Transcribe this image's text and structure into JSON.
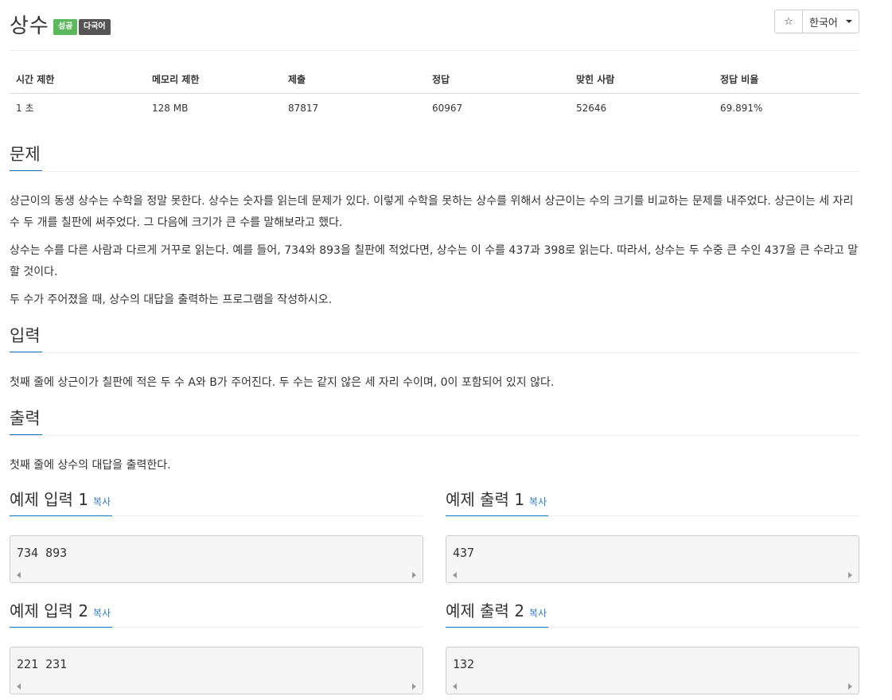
{
  "title": "상수",
  "badges": {
    "success": "성공",
    "multilang": "다국어"
  },
  "toolbar": {
    "star_icon": "☆",
    "language": "한국어"
  },
  "info": {
    "headers": [
      "시간 제한",
      "메모리 제한",
      "제출",
      "정답",
      "맞힌 사람",
      "정답 비율"
    ],
    "values": [
      "1 초",
      "128 MB",
      "87817",
      "60967",
      "52646",
      "69.891%"
    ]
  },
  "problem": {
    "heading": "문제",
    "paragraphs": [
      "상근이의 동생 상수는 수학을 정말 못한다. 상수는 숫자를 읽는데 문제가 있다. 이렇게 수학을 못하는 상수를 위해서 상근이는 수의 크기를 비교하는 문제를 내주었다. 상근이는 세 자리 수 두 개를 칠판에 써주었다. 그 다음에 크기가 큰 수를 말해보라고 했다.",
      "상수는 수를 다른 사람과 다르게 거꾸로 읽는다. 예를 들어, 734와 893을 칠판에 적었다면, 상수는 이 수를 437과 398로 읽는다. 따라서, 상수는 두 수중 큰 수인 437을 큰 수라고 말할 것이다.",
      "두 수가 주어졌을 때, 상수의 대답을 출력하는 프로그램을 작성하시오."
    ]
  },
  "input": {
    "heading": "입력",
    "text": "첫째 줄에 상근이가 칠판에 적은 두 수 A와 B가 주어진다. 두 수는 같지 않은 세 자리 수이며, 0이 포함되어 있지 않다."
  },
  "output": {
    "heading": "출력",
    "text": "첫째 줄에 상수의 대답을 출력한다."
  },
  "copy_label": "복사",
  "samples": [
    {
      "in_title": "예제 입력 1",
      "in": "734 893",
      "out_title": "예제 출력 1",
      "out": "437"
    },
    {
      "in_title": "예제 입력 2",
      "in": "221 231",
      "out_title": "예제 출력 2",
      "out": "132"
    }
  ],
  "colors": {
    "accent": "#0076c0",
    "success": "#5cb85c",
    "badge_dark": "#555555",
    "link": "#337ab7"
  }
}
